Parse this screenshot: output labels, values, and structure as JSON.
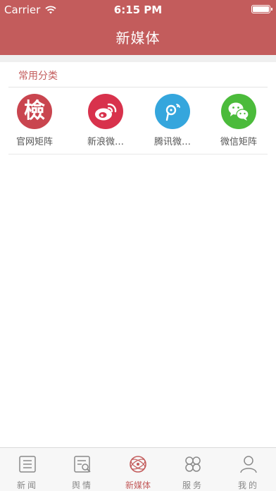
{
  "status_bar": {
    "carrier": "Carrier",
    "time": "6:15 PM"
  },
  "header": {
    "title": "新媒体",
    "color": "#c35c5c"
  },
  "section": {
    "title": "常用分类"
  },
  "categories": [
    {
      "label": "官网矩阵",
      "icon": "jian-seal-icon",
      "color": "#c9454f",
      "glyph": "檢"
    },
    {
      "label": "新浪微…",
      "icon": "weibo-icon",
      "color": "#d8324c"
    },
    {
      "label": "腾讯微…",
      "icon": "tencent-weibo-icon",
      "color": "#35a6dd"
    },
    {
      "label": "微信矩阵",
      "icon": "wechat-icon",
      "color": "#4bbb3b"
    }
  ],
  "tabbar": {
    "tabs": [
      {
        "label": "新闻",
        "icon": "news-icon"
      },
      {
        "label": "舆情",
        "icon": "public-opinion-icon"
      },
      {
        "label": "新媒体",
        "icon": "new-media-icon",
        "active": true
      },
      {
        "label": "服务",
        "icon": "service-icon"
      },
      {
        "label": "我的",
        "icon": "profile-icon"
      }
    ]
  }
}
